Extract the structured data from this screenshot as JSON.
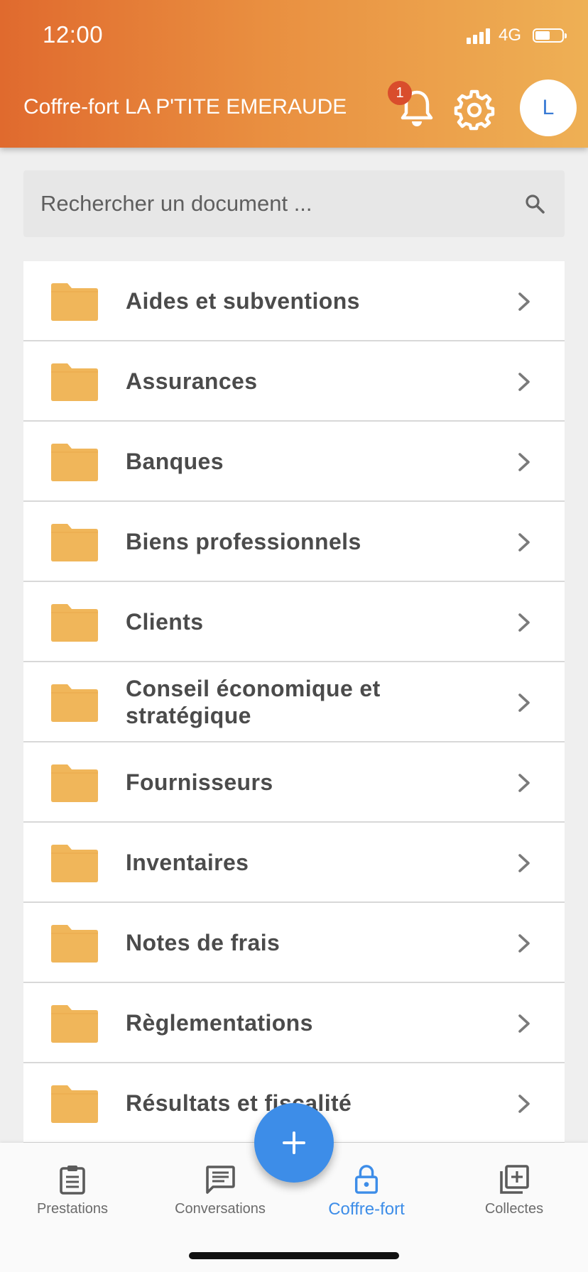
{
  "status_bar": {
    "time": "12:00",
    "network": "4G",
    "battery_level": 0.55
  },
  "header": {
    "title": "Coffre-fort LA P'TITE EMERAUDE",
    "notification_count": "1",
    "avatar_initial": "L"
  },
  "search": {
    "placeholder": "Rechercher un document ..."
  },
  "folders": [
    {
      "label": "Aides et subventions"
    },
    {
      "label": "Assurances"
    },
    {
      "label": "Banques"
    },
    {
      "label": "Biens professionnels"
    },
    {
      "label": "Clients"
    },
    {
      "label": "Conseil économique et stratégique"
    },
    {
      "label": "Fournisseurs"
    },
    {
      "label": "Inventaires"
    },
    {
      "label": "Notes de frais"
    },
    {
      "label": "Règlementations"
    },
    {
      "label": "Résultats et fiscalité"
    }
  ],
  "nav": {
    "items": [
      {
        "label": "Prestations",
        "icon": "clipboard-icon"
      },
      {
        "label": "Conversations",
        "icon": "message-icon"
      },
      {
        "label": "Coffre-fort",
        "icon": "lock-icon",
        "active": true
      },
      {
        "label": "Collectes",
        "icon": "add-library-icon"
      }
    ]
  },
  "colors": {
    "header_start": "#e06a2e",
    "header_end": "#eeb055",
    "accent": "#3d8de8",
    "folder": "#f0b65a",
    "badge": "#d94d2c"
  }
}
